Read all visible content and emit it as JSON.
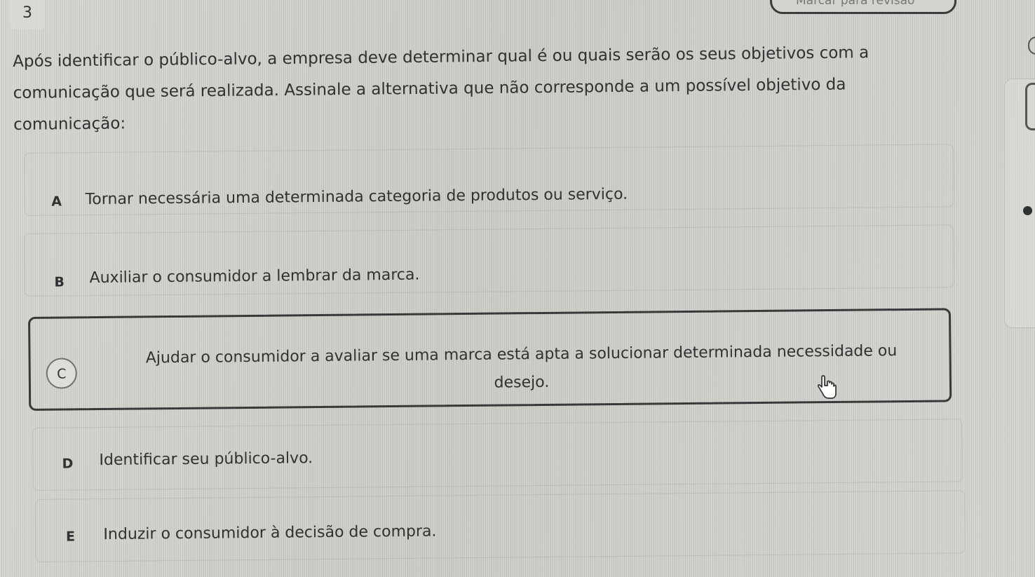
{
  "question": {
    "number": "3",
    "review_label": "Marcar para revisão",
    "prompt": "Após identificar o público-alvo, a empresa deve determinar qual é ou quais serão os seus objetivos com a comunicação que será realizada. Assinale a alternativa que não corresponde a um possível objetivo da comunicação:"
  },
  "options": [
    {
      "letter": "A",
      "text": "Tornar necessária uma determinada categoria de produtos ou serviço."
    },
    {
      "letter": "B",
      "text": "Auxiliar o consumidor a lembrar da marca."
    },
    {
      "letter": "C",
      "text": "Ajudar o consumidor a avaliar se uma marca está apta a solucionar determinada necessidade ou desejo.",
      "selected": true
    },
    {
      "letter": "D",
      "text": "Identificar seu público-alvo."
    },
    {
      "letter": "E",
      "text": "Induzir o consumidor à decisão de compra."
    }
  ],
  "icons": {
    "cursor": "hand-pointer-icon",
    "side_tab": "collapse-tab-icon",
    "side_dot": "status-dot-icon"
  },
  "colors": {
    "background": "#cfcfca",
    "text": "#2f3232",
    "selected_border": "#373a3a"
  }
}
